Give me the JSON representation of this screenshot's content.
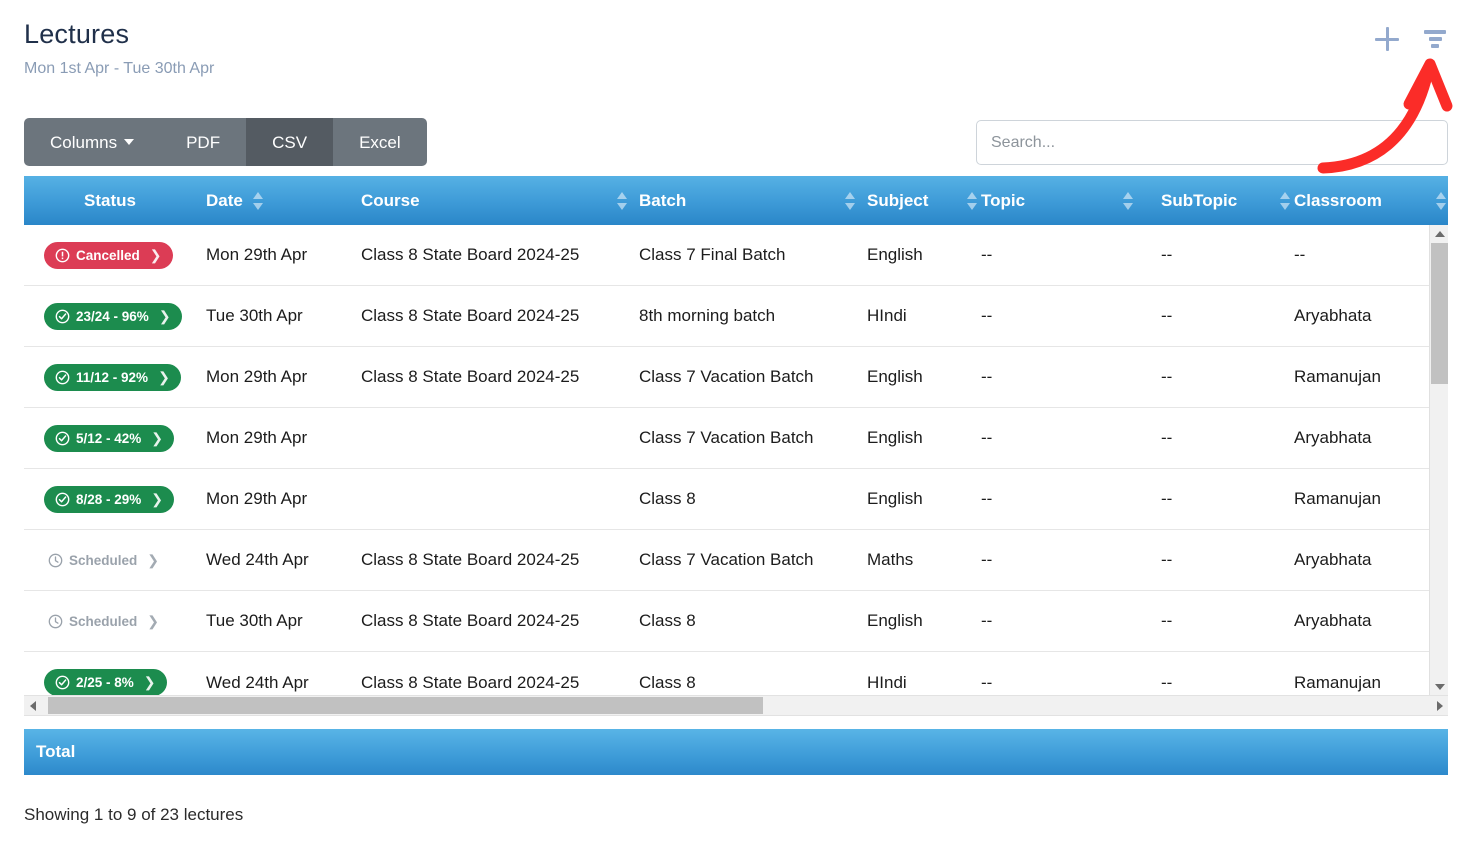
{
  "header": {
    "title": "Lectures",
    "subtitle": "Mon 1st Apr - Tue 30th Apr",
    "add_icon": "plus-icon",
    "filter_icon": "filter-icon"
  },
  "toolbar": {
    "columns_label": "Columns",
    "pdf_label": "PDF",
    "csv_label": "CSV",
    "excel_label": "Excel",
    "active": "CSV"
  },
  "search": {
    "placeholder": "Search...",
    "value": ""
  },
  "table": {
    "columns": [
      {
        "key": "status",
        "label": "Status",
        "sortable": false
      },
      {
        "key": "date",
        "label": "Date",
        "sortable": true
      },
      {
        "key": "course",
        "label": "Course",
        "sortable": true
      },
      {
        "key": "batch",
        "label": "Batch",
        "sortable": true
      },
      {
        "key": "subject",
        "label": "Subject",
        "sortable": true
      },
      {
        "key": "topic",
        "label": "Topic",
        "sortable": true
      },
      {
        "key": "subtopic",
        "label": "SubTopic",
        "sortable": true
      },
      {
        "key": "classroom",
        "label": "Classroom",
        "sortable": true
      }
    ],
    "rows": [
      {
        "status": {
          "text": "Cancelled",
          "kind": "cancelled",
          "icon": "exclamation-circle-icon",
          "chevron": "❯"
        },
        "date": "Mon 29th Apr",
        "course": "Class 8 State Board 2024-25",
        "batch": "Class 7 Final Batch",
        "subject": "English",
        "topic": "--",
        "subtopic": "--",
        "classroom": "--"
      },
      {
        "status": {
          "text": "23/24 - 96%",
          "kind": "progress",
          "icon": "check-circle-icon",
          "chevron": "❯"
        },
        "date": "Tue 30th Apr",
        "course": "Class 8 State Board 2024-25",
        "batch": "8th morning batch",
        "subject": "HIndi",
        "topic": "--",
        "subtopic": "--",
        "classroom": "Aryabhata"
      },
      {
        "status": {
          "text": "11/12 - 92%",
          "kind": "progress",
          "icon": "check-circle-icon",
          "chevron": "❯"
        },
        "date": "Mon 29th Apr",
        "course": "Class 8 State Board 2024-25",
        "batch": "Class 7 Vacation Batch",
        "subject": "English",
        "topic": "--",
        "subtopic": "--",
        "classroom": "Ramanujan"
      },
      {
        "status": {
          "text": "5/12 - 42%",
          "kind": "progress",
          "icon": "check-circle-icon",
          "chevron": "❯"
        },
        "date": "Mon 29th Apr",
        "course": "",
        "batch": "Class 7 Vacation Batch",
        "subject": "English",
        "topic": "--",
        "subtopic": "--",
        "classroom": "Aryabhata"
      },
      {
        "status": {
          "text": "8/28 - 29%",
          "kind": "progress",
          "icon": "check-circle-icon",
          "chevron": "❯"
        },
        "date": "Mon 29th Apr",
        "course": "",
        "batch": "Class 8",
        "subject": "English",
        "topic": "--",
        "subtopic": "--",
        "classroom": "Ramanujan"
      },
      {
        "status": {
          "text": "Scheduled",
          "kind": "plain",
          "icon": "clock-icon",
          "chevron": "❯"
        },
        "date": "Wed 24th Apr",
        "course": "Class 8 State Board 2024-25",
        "batch": "Class 7 Vacation Batch",
        "subject": "Maths",
        "topic": "--",
        "subtopic": "--",
        "classroom": "Aryabhata"
      },
      {
        "status": {
          "text": "Scheduled",
          "kind": "plain",
          "icon": "clock-icon",
          "chevron": "❯"
        },
        "date": "Tue 30th Apr",
        "course": "Class 8 State Board 2024-25",
        "batch": "Class 8",
        "subject": "English",
        "topic": "--",
        "subtopic": "--",
        "classroom": "Aryabhata"
      },
      {
        "status": {
          "text": "2/25 - 8%",
          "kind": "progress",
          "icon": "check-circle-icon",
          "chevron": "❯"
        },
        "date": "Wed 24th Apr",
        "course": "Class 8 State Board 2024-25",
        "batch": "Class 8",
        "subject": "HIndi",
        "topic": "--",
        "subtopic": "--",
        "classroom": "Ramanujan"
      }
    ],
    "footer_label": "Total"
  },
  "pagination": {
    "showing_text": "Showing 1 to 9 of 23 lectures"
  },
  "annotation": {
    "arrow_color": "#fb2c28",
    "points_to": "filter-icon"
  },
  "colors": {
    "header_blue": "#3d9ad7",
    "toolbar_gray": "#6c757d",
    "toolbar_active": "#545b62",
    "badge_green": "#1c8c4e",
    "badge_red": "#dc3c55",
    "badge_muted": "#9aa2ab",
    "title": "#20304a",
    "subtitle": "#8a9cb5",
    "icon_blue": "#93a9cd"
  }
}
